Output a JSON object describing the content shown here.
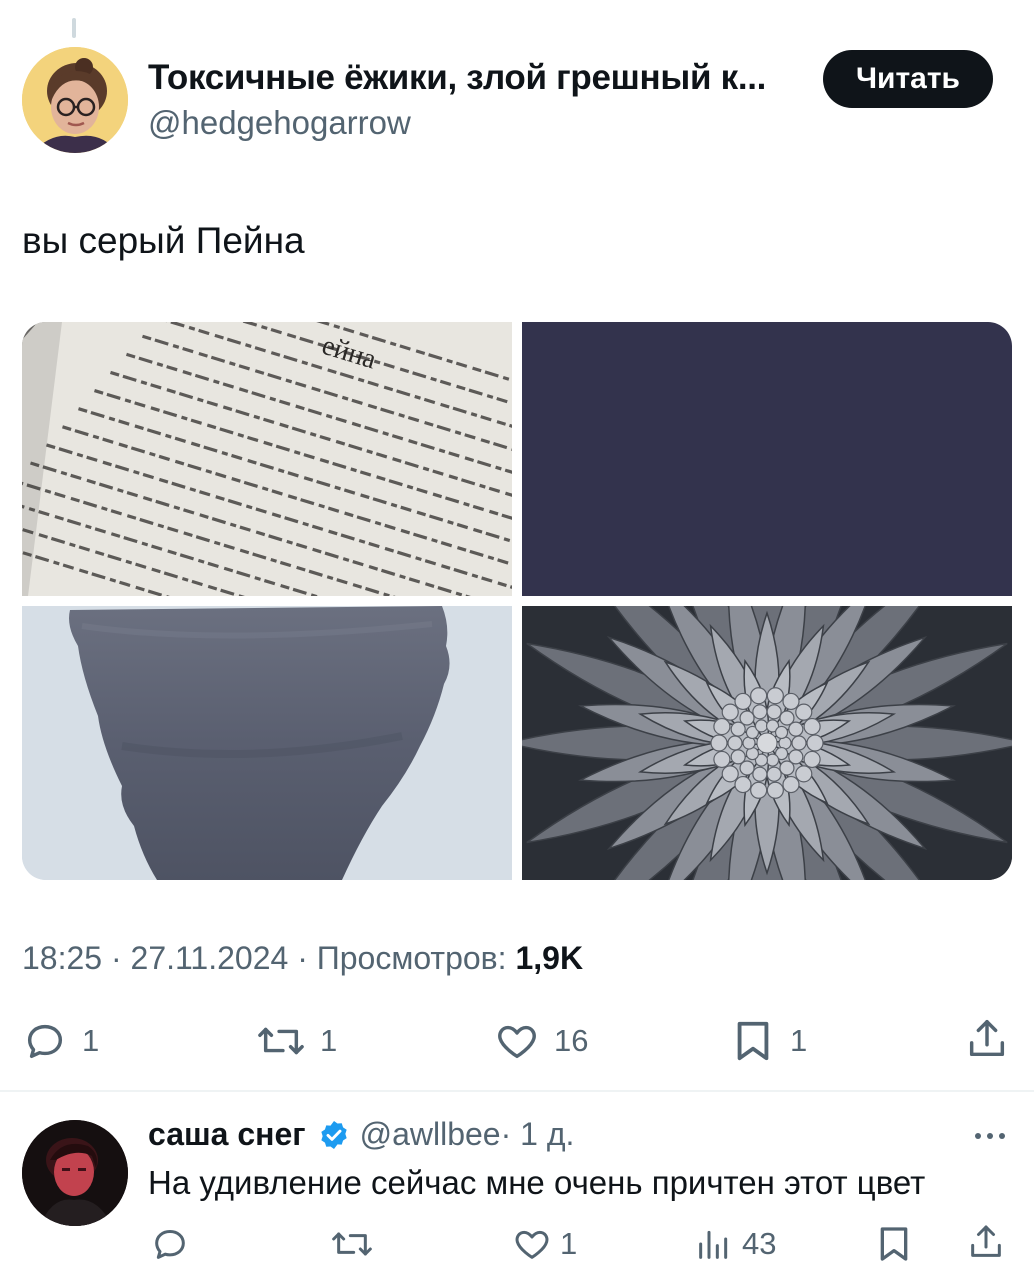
{
  "tweet": {
    "author_name": "Токсичные ёжики, злой грешный к...",
    "author_handle": "@hedgehogarrow",
    "follow_label": "Читать",
    "text": "вы серый Пейна",
    "book_heading": "ейна",
    "time": "18:25",
    "date": "27.11.2024",
    "views_label": "Просмотров:",
    "views_count": "1,9K",
    "separator": " · ",
    "stats": {
      "replies": "1",
      "retweets": "1",
      "likes": "16",
      "bookmarks": "1"
    }
  },
  "reply": {
    "author_name": "саша снег",
    "author_handle": "@awllbee",
    "time_ago": "· 1 д.",
    "text": "На удивление сейчас мне очень причтен этот цвет",
    "stats": {
      "likes": "1",
      "views": "43"
    }
  },
  "colors": {
    "text_primary": "#0f1419",
    "text_secondary": "#536471",
    "verified_blue": "#1d9bf0",
    "paynes_grey_swatch": "#33334d"
  }
}
